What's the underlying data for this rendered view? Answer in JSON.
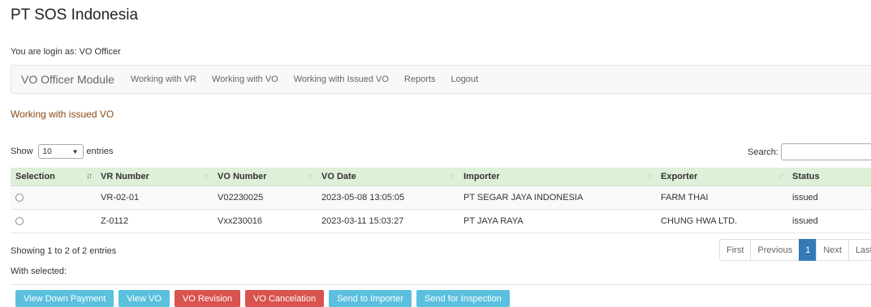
{
  "header": {
    "company": "PT SOS Indonesia",
    "login_info": "You are login as: VO Officer"
  },
  "nav": {
    "brand": "VO Officer Module",
    "links": [
      "Working with VR",
      "Working with VO",
      "Working with Issued VO",
      "Reports",
      "Logout"
    ]
  },
  "section_heading": "Working with issued VO",
  "table_controls": {
    "show_label": "Show",
    "entries_value": "10",
    "entries_label": "entries",
    "search_label": "Search:",
    "search_value": ""
  },
  "table": {
    "columns": [
      "Selection",
      "VR Number",
      "VO Number",
      "VO Date",
      "Importer",
      "Exporter",
      "Status"
    ],
    "rows": [
      [
        "",
        "VR-02-01",
        "V02230025",
        "2023-05-08 13:05:05",
        "PT SEGAR JAYA INDONESIA",
        "FARM THAI",
        "issued"
      ],
      [
        "",
        "Z-0112",
        "Vxx230016",
        "2023-03-11 15:03:27",
        "PT JAYA RAYA",
        "CHUNG HWA LTD.",
        "issued"
      ]
    ]
  },
  "info": "Showing 1 to 2 of 2 entries",
  "pagination": {
    "first": "First",
    "previous": "Previous",
    "current": "1",
    "next": "Next",
    "last": "Last"
  },
  "with_selected": "With selected:",
  "actions": [
    "View Down Payment",
    "View VO",
    "VO Revision",
    "VO Cancelation",
    "Send to Importer",
    "Send for Inspection"
  ],
  "colors": {
    "info_button": "#5bc0de",
    "danger_button": "#d9534f",
    "table_header": "#dff0d8",
    "heading": "#8b4a14",
    "active_page": "#337ab7"
  }
}
